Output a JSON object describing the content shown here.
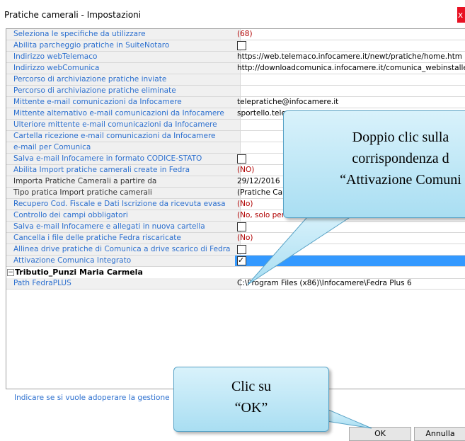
{
  "window": {
    "title": "Pratiche camerali - Impostazioni",
    "close_label": "x"
  },
  "properties": [
    {
      "name": "Seleziona le specifiche da utilizzare",
      "value": "(68)",
      "value_color": "red"
    },
    {
      "name": "Abilita parcheggio pratiche in SuiteNotaro",
      "checkbox": false
    },
    {
      "name": "Indirizzo webTelemaco",
      "value": "https://web.telemaco.infocamere.it/newt/pratiche/home.htm"
    },
    {
      "name": "Indirizzo webComunica",
      "value": "http://downloadcomunica.infocamere.it/comunica_webinstaller"
    },
    {
      "name": "Percorso di archiviazione pratiche inviate",
      "value": ""
    },
    {
      "name": "Percorso di archiviazione pratiche eliminate",
      "value": ""
    },
    {
      "name": "Mittente e-mail comunicazioni da Infocamere",
      "value": "telepratiche@infocamere.it"
    },
    {
      "name": "Mittente alternativo e-mail comunicazioni da Infocamere",
      "value": "sportello.telem"
    },
    {
      "name": "Ulteriore mittente e-mail comunicazioni da Infocamere",
      "value": ""
    },
    {
      "name": "Cartella ricezione e-mail comunicazioni da Infocamere",
      "value": ""
    },
    {
      "name": "e-mail per Comunica",
      "value": ""
    },
    {
      "name": "Salva e-mail Infocamere in formato CODICE-STATO",
      "checkbox": false
    },
    {
      "name": "Abilita Import pratiche camerali create in Fedra",
      "value": "(NO)",
      "value_color": "red"
    },
    {
      "name": "Importa Pratiche Camerali a partire da",
      "value": "29/12/2016",
      "dark": true
    },
    {
      "name": "Tipo pratica Import pratiche camerali",
      "value": "(Pratiche Cam",
      "dark": true
    },
    {
      "name": "Recupero Cod. Fiscale e Dati Iscrizione da ricevuta evasa",
      "value": "(No)",
      "value_color": "red"
    },
    {
      "name": "Controllo dei campi obbligatori",
      "value": "(No, solo per i campi as",
      "value_color": "red"
    },
    {
      "name": "Salva e-mail Infocamere e allegati in nuova cartella",
      "checkbox": false
    },
    {
      "name": "Cancella i file delle pratiche Fedra riscaricate",
      "value": "(No)",
      "value_color": "red"
    },
    {
      "name": "Allinea drive pratiche di Comunica a drive scarico di Fedra",
      "checkbox": false
    },
    {
      "name": "Attivazione Comunica Integrato",
      "checkbox": true,
      "selected": true
    }
  ],
  "category": {
    "label": "Tributio_Punzi Maria Carmela",
    "toggle": "−"
  },
  "category_properties": [
    {
      "name": "Path FedraPLUS",
      "value": "C:\\Program Files (x86)\\Infocamere\\Fedra Plus 6"
    }
  ],
  "description": "Indicare se si vuole adoperare la gestione",
  "buttons": {
    "ok": "OK",
    "cancel": "Annulla"
  },
  "callouts": {
    "first": [
      "Doppio clic sulla",
      "corrispondenza d",
      "“Attivazione Comuni"
    ],
    "second": [
      "Clic su",
      "“OK”"
    ]
  }
}
